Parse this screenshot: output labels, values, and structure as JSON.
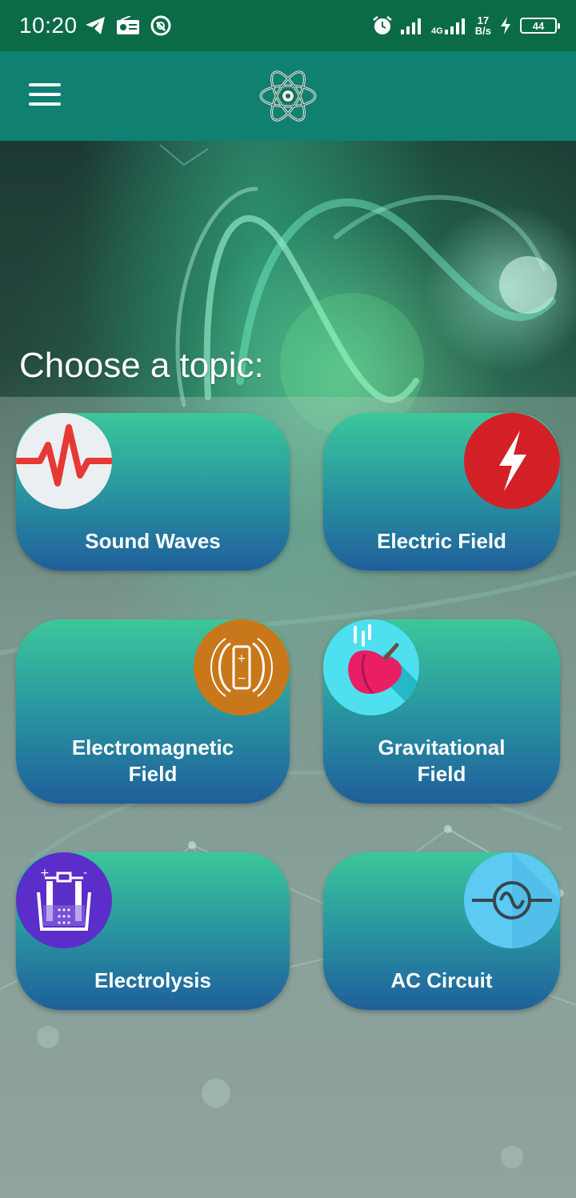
{
  "status_bar": {
    "time": "10:20",
    "network": "4G",
    "speed_value": "17",
    "speed_unit": "B/s",
    "battery": "44"
  },
  "app_bar": {
    "menu_icon": "hamburger-menu-icon",
    "logo_icon": "atom-logo-icon"
  },
  "hero": {
    "title": "Choose a topic:"
  },
  "topics": [
    {
      "label": "Sound Waves",
      "icon": "sound-wave-icon",
      "icon_bg": "#eceff1"
    },
    {
      "label": "Electric Field",
      "icon": "lightning-icon",
      "icon_bg": "#d32027"
    },
    {
      "label_line1": "Electromagnetic",
      "label_line2": "Field",
      "icon": "electromagnet-icon",
      "icon_bg": "#c8781a"
    },
    {
      "label_line1": "Gravitational",
      "label_line2": "Field",
      "icon": "falling-apple-icon",
      "icon_bg": "#4fe0ef"
    },
    {
      "label": "Electrolysis",
      "icon": "electrolysis-cell-icon",
      "icon_bg": "#5b2ec9"
    },
    {
      "label": "AC Circuit",
      "icon": "ac-source-icon",
      "icon_bg": "#5ccaf2"
    }
  ],
  "colors": {
    "status_bar": "#0b6b46",
    "app_bar": "#0f8072",
    "card_top": "#3cc79a",
    "card_bottom": "#1f5f9c"
  }
}
